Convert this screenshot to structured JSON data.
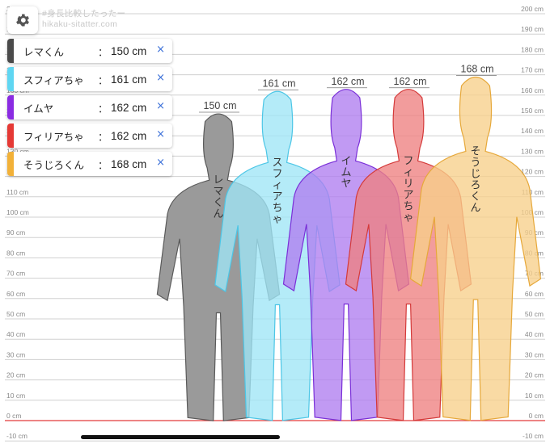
{
  "app": {
    "watermark_line1": "#身長比較したったー",
    "watermark_line2": "hikaku-sitatter.com"
  },
  "settings": {
    "icon": "gear-icon"
  },
  "legend": {
    "colon": "：",
    "close_glyph": "×",
    "close_color": "#3a6fd8"
  },
  "chart_data": {
    "type": "height-comparison",
    "unit": "cm",
    "ylim": [
      -10,
      200
    ],
    "tick_step": 10,
    "grid": true,
    "ground_line_color": "#e23b3b",
    "ticks": [
      "-10 cm",
      "0 cm",
      "10 cm",
      "20 cm",
      "30 cm",
      "40 cm",
      "50 cm",
      "60 cm",
      "70 cm",
      "80 cm",
      "90 cm",
      "100 cm",
      "110 cm",
      "120 cm",
      "130 cm",
      "140 cm",
      "150 cm",
      "160 cm",
      "170 cm",
      "180 cm",
      "190 cm",
      "200 cm"
    ],
    "characters": [
      {
        "name": "レマくん",
        "height": 150,
        "height_label": "150 cm",
        "color": "#4a4a4a",
        "fill": "#9a9a9a",
        "stroke": "#5a5a5a"
      },
      {
        "name": "スフィアちゃ",
        "height": 161,
        "height_label": "161 cm",
        "color": "#5fd6f2",
        "fill": "#9fe6f6",
        "stroke": "#4cc6e6"
      },
      {
        "name": "イムヤ",
        "height": 162,
        "height_label": "162 cm",
        "color": "#8a2be2",
        "fill": "#b07ef0",
        "stroke": "#7a2fd8"
      },
      {
        "name": "フィリアちゃ",
        "height": 162,
        "height_label": "162 cm",
        "color": "#e53935",
        "fill": "#ee8080",
        "stroke": "#d43a3a"
      },
      {
        "name": "そうじろくん",
        "height": 168,
        "height_label": "168 cm",
        "color": "#f2b138",
        "fill": "#f7d08a",
        "stroke": "#e6a83a"
      }
    ]
  }
}
